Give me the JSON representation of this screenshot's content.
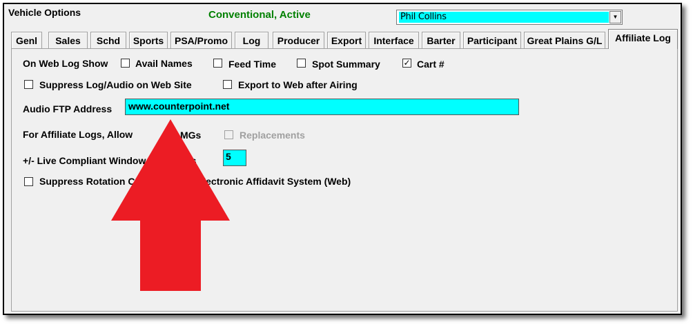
{
  "window": {
    "title": "Vehicle Options",
    "status": "Conventional, Active",
    "user_selected": "Phil Collins",
    "dropdown_icon": "chevron-down-icon"
  },
  "tabs": [
    {
      "label": "Genl",
      "active": false
    },
    {
      "label": "Sales",
      "active": false
    },
    {
      "label": "Schd",
      "active": false
    },
    {
      "label": "Sports",
      "active": false
    },
    {
      "label": "PSA/Promo",
      "active": false
    },
    {
      "label": "Log",
      "active": false
    },
    {
      "label": "Producer",
      "active": false
    },
    {
      "label": "Export",
      "active": false
    },
    {
      "label": "Interface",
      "active": false
    },
    {
      "label": "Barter",
      "active": false
    },
    {
      "label": "Participant",
      "active": false
    },
    {
      "label": "Great Plains G/L",
      "active": false
    },
    {
      "label": "Affiliate Log",
      "active": true
    }
  ],
  "form": {
    "web_log_show_label": "On Web Log Show",
    "avail_names": {
      "label": "Avail Names",
      "checked": false
    },
    "feed_time": {
      "label": "Feed Time",
      "checked": false
    },
    "spot_summary": {
      "label": "Spot Summary",
      "checked": false
    },
    "cart_num": {
      "label": "Cart #",
      "checked": true
    },
    "suppress_log": {
      "label": "Suppress Log/Audio on Web Site",
      "checked": false
    },
    "export_web": {
      "label": "Export to Web after Airing",
      "checked": false
    },
    "ftp_label": "Audio FTP Address",
    "ftp_value": "www.counterpoint.net",
    "affiliate_allow_label": "For Affiliate Logs, Allow",
    "mgs": {
      "label": "MGs",
      "checked": true
    },
    "replacements": {
      "label": "Replacements",
      "checked": false,
      "disabled": true
    },
    "compliant_label": "+/- Live Compliant Window in Minutes",
    "compliant_value": "5",
    "suppress_rotation": {
      "label": "Suppress Rotation Compliance in Electronic Affidavit System (Web)",
      "checked": false
    }
  },
  "annotation": {
    "icon": "red-arrow-up-icon",
    "color": "#ec1c24"
  },
  "colors": {
    "status_green": "#008000",
    "input_cyan": "#00ffff",
    "panel_bg": "#f0f0f0"
  }
}
